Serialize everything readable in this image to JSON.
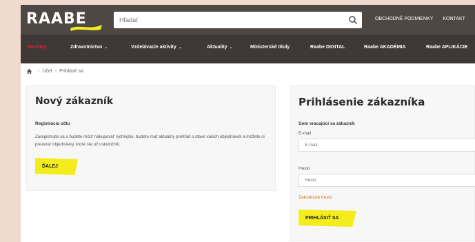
{
  "header": {
    "logo_text": "RAABE",
    "search": {
      "placeholder": "Hľadať",
      "value": ""
    },
    "links": [
      "OBCHODNÉ PODMIENKY",
      "KONTAKT"
    ]
  },
  "nav": {
    "items": [
      {
        "label": "Novinky",
        "dropdown": false,
        "active": true
      },
      {
        "label": "Zdravotníctvo",
        "dropdown": true
      },
      {
        "label": "Vzdelávacie aktivity",
        "dropdown": true
      },
      {
        "label": "Aktuality",
        "dropdown": true
      },
      {
        "label": "Ministerské tituly",
        "dropdown": false
      },
      {
        "label": "Raabe DIGITAL",
        "dropdown": false
      },
      {
        "label": "Raabe AKADÉMIA",
        "dropdown": false
      },
      {
        "label": "Raabe APLIKÁCIE",
        "dropdown": false
      }
    ]
  },
  "breadcrumb": {
    "items": [
      "Účet",
      "Prihlásiť sa"
    ]
  },
  "new_customer": {
    "title": "Nový zákazník",
    "subtitle": "Registrácia účtu",
    "description": "Zaregistrujte sa a budete môcť nakupovať rýchlejšie, budete mať aktuálny prehľad o stave vašich objednávok a môžete si prezerať objednávky, ktoré ste už uskutočnili.",
    "button": "ĎALEJ"
  },
  "login": {
    "title": "Prihlásenie zákazníka",
    "subtitle": "Som vracajúci sa zákazník",
    "email_label": "E-mail",
    "email_placeholder": "E-mail",
    "password_label": "Heslo",
    "password_placeholder": "Heslo",
    "forgot": "Zabudnuté heslo",
    "button": "PRIHLÁSIŤ SA"
  },
  "colors": {
    "header_bg": "#4e4845",
    "nav_bg": "#3e3937",
    "accent_yellow": "#f4ec1d",
    "active_red": "#e0202a",
    "link_orange": "#c2771b"
  }
}
